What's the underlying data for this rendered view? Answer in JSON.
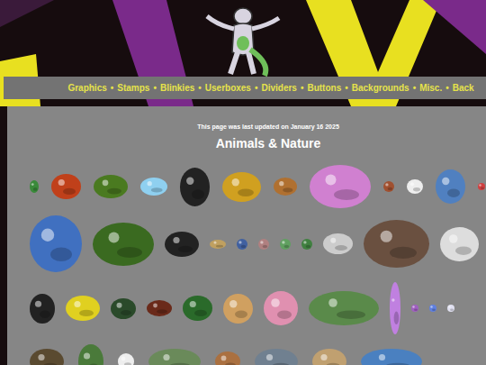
{
  "nav": {
    "links": [
      "Graphics",
      "Stamps",
      "Blinkies",
      "Userboxes",
      "Dividers",
      "Buttons",
      "Backgrounds",
      "Misc.",
      "Back"
    ],
    "separator": "•"
  },
  "updated": "This page was last updated on January 16 2025",
  "title": "Animals & Nature"
}
